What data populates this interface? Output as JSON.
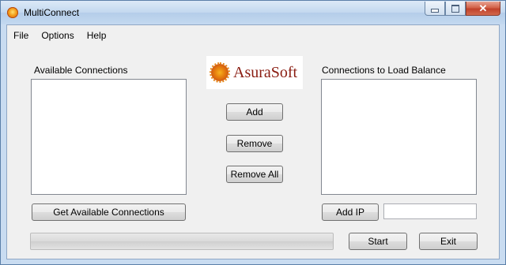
{
  "window": {
    "title": "MultiConnect",
    "close_glyph": "✕"
  },
  "menu": {
    "items": [
      "File",
      "Options",
      "Help"
    ]
  },
  "logo": {
    "text": "AsuraSoft"
  },
  "left_panel": {
    "label": "Available Connections",
    "items": [],
    "button": "Get Available Connections"
  },
  "middle": {
    "add": "Add",
    "remove": "Remove",
    "remove_all": "Remove All"
  },
  "right_panel": {
    "label": "Connections to Load Balance",
    "items": [],
    "add_ip_button": "Add IP",
    "ip_value": ""
  },
  "footer": {
    "progress_fraction": 0,
    "start": "Start",
    "exit": "Exit"
  }
}
